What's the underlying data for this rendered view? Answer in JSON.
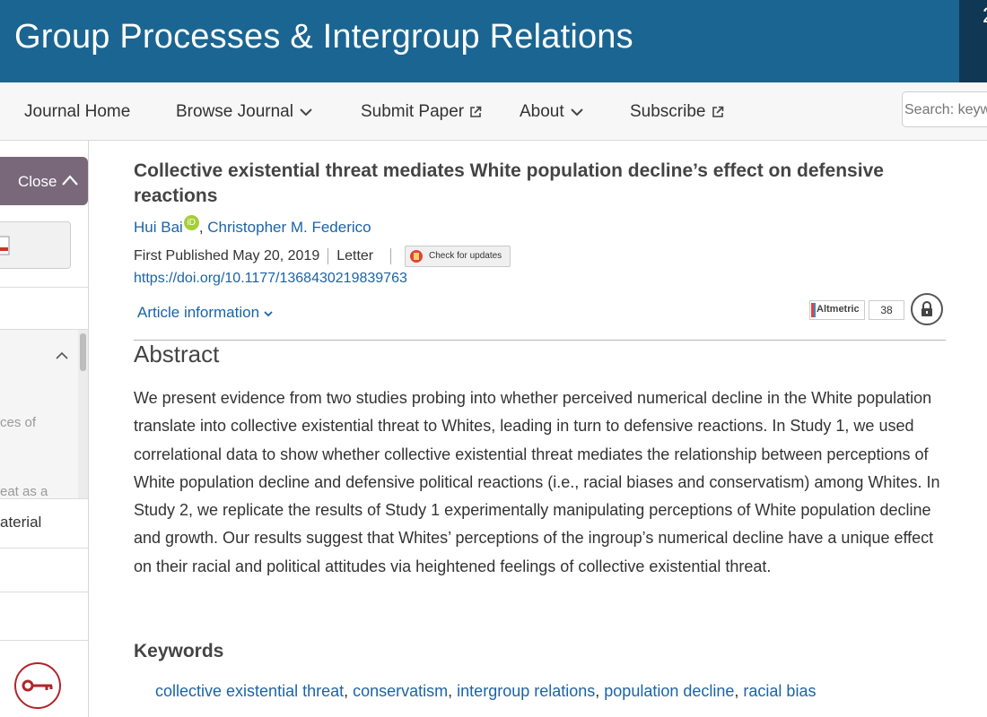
{
  "header": {
    "journal_title": "Group Processes & Intergroup Relations",
    "corner_text": "2"
  },
  "nav": {
    "items": [
      {
        "label": "Journal Home",
        "icon": ""
      },
      {
        "label": "Browse Journal",
        "icon": "chevron-down-icon"
      },
      {
        "label": "Submit Paper",
        "icon": "external-link-icon"
      },
      {
        "label": "About",
        "icon": "chevron-down-icon"
      },
      {
        "label": "Subscribe",
        "icon": "external-link-icon"
      }
    ],
    "search_placeholder": "Search: keyw"
  },
  "sidebar": {
    "close_label": "Close",
    "toc_text_1": "ces of",
    "toc_text_2": "eat as a",
    "item_label": "aterial"
  },
  "article": {
    "title": "Collective existential threat mediates White population decline’s effect on defensive reactions",
    "authors": [
      "Hui Bai",
      "Christopher M. Federico"
    ],
    "orcid_badge": "iD",
    "first_published": "First Published May 20, 2019",
    "type": "Letter",
    "check_updates": "Check for updates",
    "doi": "https://doi.org/10.1177/1368430219839763",
    "article_info_label": "Article information",
    "altmetric_label": "Altmetric",
    "altmetric_score": "38",
    "abstract_heading": "Abstract",
    "abstract": "We present evidence from two studies probing into whether perceived numerical decline in the White population translate into collective existential threat to Whites, leading in turn to defensive reactions. In Study 1, we used correlational data to show whether collective existential threat mediates the relationship between perceptions of White population decline and defensive political reactions (i.e., racial biases and conservatism) among Whites. In Study 2, we replicate the results of Study 1 experimentally manipulating perceptions of White population decline and growth. Our results suggest that Whites’ perceptions of the ingroup’s numerical decline have a unique effect on their racial and political attitudes via heightened feelings of collective existential threat.",
    "keywords_heading": "Keywords",
    "keywords": [
      "collective existential threat",
      "conservatism",
      "intergroup relations",
      "population decline",
      "racial bias"
    ]
  },
  "colors": {
    "banner": "#1b6592",
    "banner_corner": "#103753",
    "link": "#1a64a8",
    "close_tab": "#78687a",
    "key_button": "#b0252b",
    "orcid": "#a6ce39"
  }
}
